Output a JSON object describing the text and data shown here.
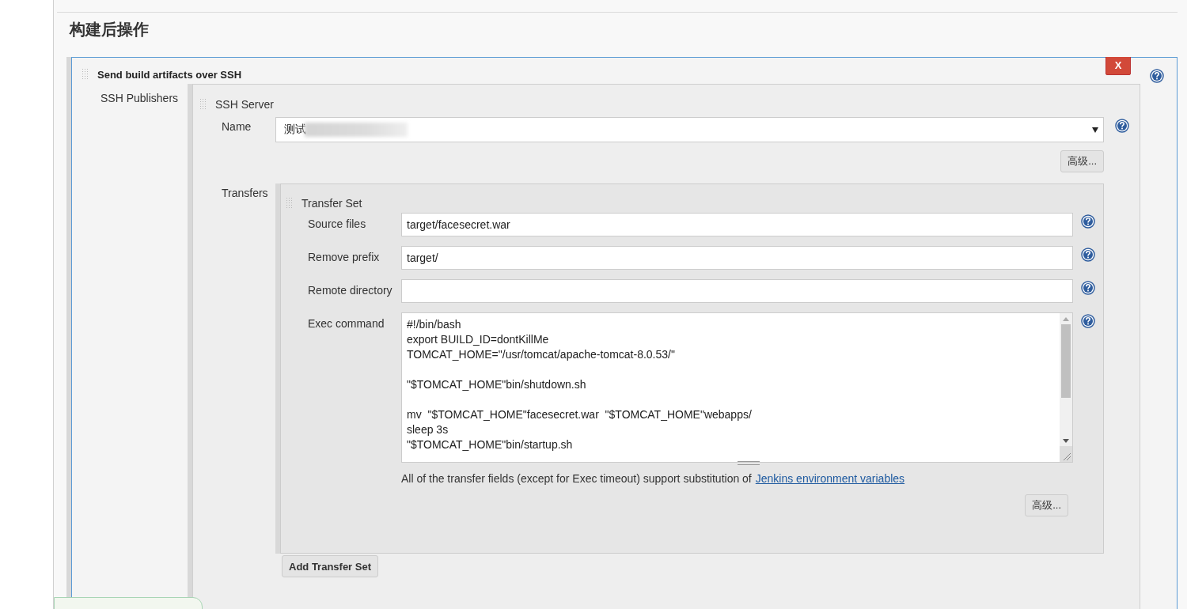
{
  "section_title": "构建后操作",
  "step": {
    "title": "Send build artifacts over SSH",
    "delete_button": "X",
    "publishers_label": "SSH Publishers",
    "server": {
      "title": "SSH Server",
      "name_label": "Name",
      "name_value": "测试",
      "advanced_button": "高级..."
    },
    "transfers_label": "Transfers",
    "transfer_set": {
      "title": "Transfer Set",
      "fields": [
        {
          "label": "Source files",
          "value": "target/facesecret.war"
        },
        {
          "label": "Remove prefix",
          "value": "target/"
        },
        {
          "label": "Remote directory"
        }
      ],
      "exec_label": "Exec command",
      "exec_command": "#!/bin/bash\nexport BUILD_ID=dontKillMe\nTOMCAT_HOME=\"/usr/tomcat/apache-tomcat-8.0.53/\"\n\n\"$TOMCAT_HOME\"bin/shutdown.sh\n\nmv  \"$TOMCAT_HOME\"facesecret.war  \"$TOMCAT_HOME\"webapps/\nsleep 3s\n\"$TOMCAT_HOME\"bin/startup.sh",
      "note": "All of the transfer fields (except for Exec timeout) support substitution of",
      "note_link": "Jenkins environment variables",
      "advanced_button": "高级..."
    },
    "add_button": "Add Transfer Set"
  }
}
